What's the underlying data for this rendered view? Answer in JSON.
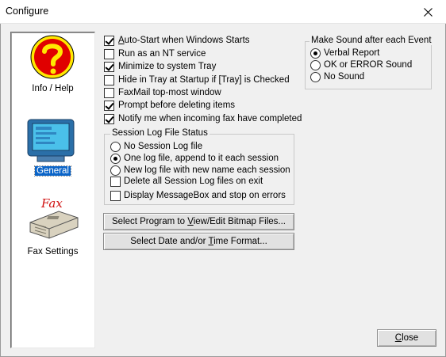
{
  "window": {
    "title": "Configure"
  },
  "sidebar": {
    "items": [
      {
        "label": "Info / Help",
        "icon": "question-icon"
      },
      {
        "label": "General",
        "icon": "monitor-icon",
        "selected": true
      },
      {
        "label": "Fax Settings",
        "icon": "fax-machine-icon",
        "icon_text": "Fax"
      }
    ]
  },
  "options": {
    "auto_start": {
      "pre": "",
      "accel": "A",
      "post": "uto-Start when Windows Starts",
      "checked": true
    },
    "nt_service": {
      "label": "Run as an NT service",
      "checked": false
    },
    "minimize_tray": {
      "label": "Minimize to system Tray",
      "checked": true
    },
    "hide_tray": {
      "label": "Hide in Tray at Startup if [Tray] is Checked",
      "checked": false
    },
    "top_most": {
      "label": "FaxMail top-most window",
      "checked": false
    },
    "prompt_delete": {
      "label": "Prompt before deleting items",
      "checked": true
    },
    "notify_fax": {
      "label": "Notify me when incoming fax have completed",
      "checked": true
    }
  },
  "session_log": {
    "title": "Session Log File Status",
    "radios": [
      {
        "label": "No Session Log file",
        "checked": false
      },
      {
        "label": "One log file, append to it each session",
        "checked": true
      },
      {
        "label": "New log file with new name each session",
        "checked": false
      }
    ],
    "checks": [
      {
        "label": "Delete all Session Log files on exit",
        "checked": false
      },
      {
        "label": "Display MessageBox and stop on errors",
        "checked": false
      }
    ]
  },
  "sound": {
    "title": "Make Sound after each Event",
    "radios": [
      {
        "label": "Verbal Report",
        "checked": true
      },
      {
        "label": "OK or ERROR Sound",
        "checked": false
      },
      {
        "label": "No Sound",
        "checked": false
      }
    ]
  },
  "buttons": {
    "bitmap": {
      "pre": "Select Program to ",
      "accel": "V",
      "post": "iew/Edit Bitmap Files..."
    },
    "datetime": {
      "pre": "Select Date and/or ",
      "accel": "T",
      "post": "ime Format..."
    },
    "close": {
      "pre": "",
      "accel": "C",
      "post": "lose"
    }
  }
}
